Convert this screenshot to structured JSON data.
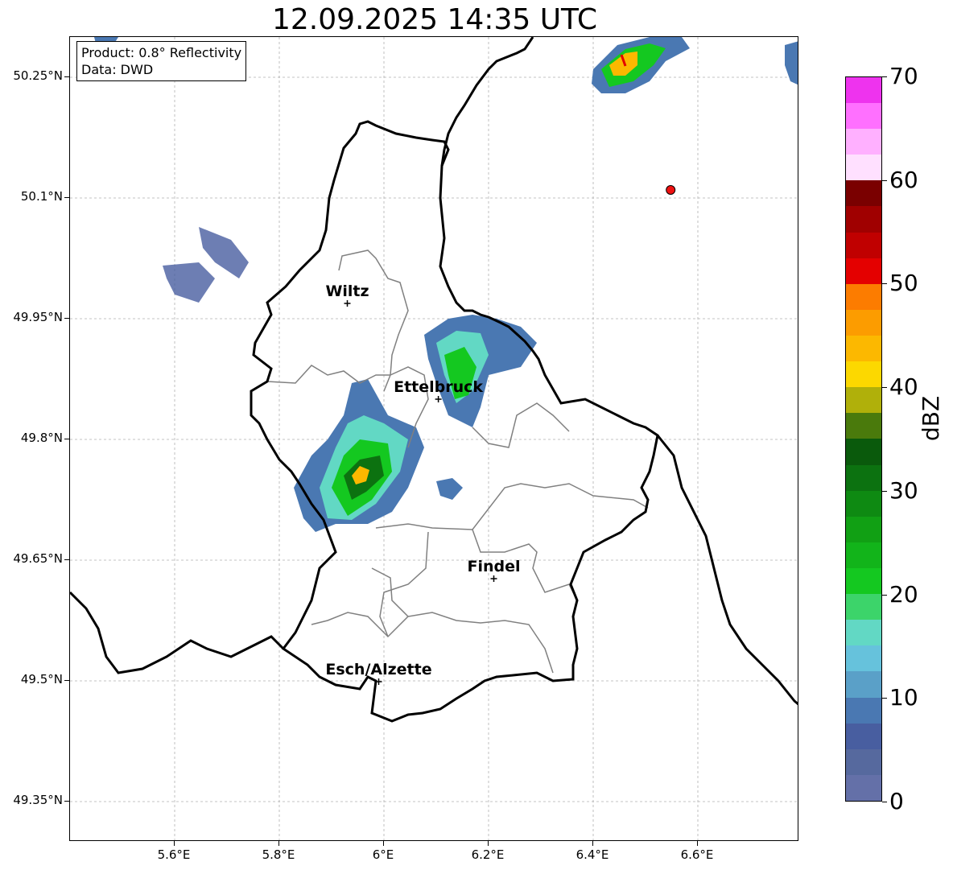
{
  "title": "12.09.2025 14:35 UTC",
  "info": {
    "product": "Product: 0.8° Reflectivity",
    "data": "Data: DWD"
  },
  "lat_ticks": [
    {
      "label": "50.25°N",
      "value": 50.25
    },
    {
      "label": "50.1°N",
      "value": 50.1
    },
    {
      "label": "49.95°N",
      "value": 49.95
    },
    {
      "label": "49.8°N",
      "value": 49.8
    },
    {
      "label": "49.65°N",
      "value": 49.65
    },
    {
      "label": "49.5°N",
      "value": 49.5
    },
    {
      "label": "49.35°N",
      "value": 49.35
    }
  ],
  "lon_ticks": [
    {
      "label": "5.6°E",
      "value": 5.6
    },
    {
      "label": "5.8°E",
      "value": 5.8
    },
    {
      "label": "6°E",
      "value": 6.0
    },
    {
      "label": "6.2°E",
      "value": 6.2
    },
    {
      "label": "6.4°E",
      "value": 6.4
    },
    {
      "label": "6.6°E",
      "value": 6.6
    }
  ],
  "cities": [
    {
      "name": "Wiltz",
      "lon": 5.93,
      "lat": 49.969
    },
    {
      "name": "Ettelbruck",
      "lon": 6.104,
      "lat": 49.85
    },
    {
      "name": "Findel",
      "lon": 6.21,
      "lat": 49.627
    },
    {
      "name": "Esch/Alzette",
      "lon": 5.99,
      "lat": 49.499
    }
  ],
  "radar_site": {
    "lon": 6.548,
    "lat": 50.11,
    "color": "#ee1111"
  },
  "colorbar": {
    "label": "dBZ",
    "tick_labels": [
      "0",
      "10",
      "20",
      "30",
      "40",
      "50",
      "60",
      "70"
    ],
    "min": 0,
    "max": 70,
    "step": 2.5,
    "colors": [
      "#6470a8",
      "#56699e",
      "#485ea0",
      "#4a78b2",
      "#5aa0c8",
      "#66c2dc",
      "#62d8c4",
      "#3cd46a",
      "#14c820",
      "#12b41a",
      "#11a014",
      "#0e8a12",
      "#0c7210",
      "#0a5a0c",
      "#4a7a0c",
      "#b0b00a",
      "#fcd800",
      "#fcb800",
      "#fc9c00",
      "#fc7c00",
      "#e40000",
      "#c00000",
      "#a00000",
      "#7a0000",
      "#ffe0ff",
      "#ffb0ff",
      "#ff70ff",
      "#ee33ee"
    ]
  },
  "colors": {
    "country_border": "#000000",
    "canton_border": "#808080",
    "grid": "#b0b0b0"
  }
}
